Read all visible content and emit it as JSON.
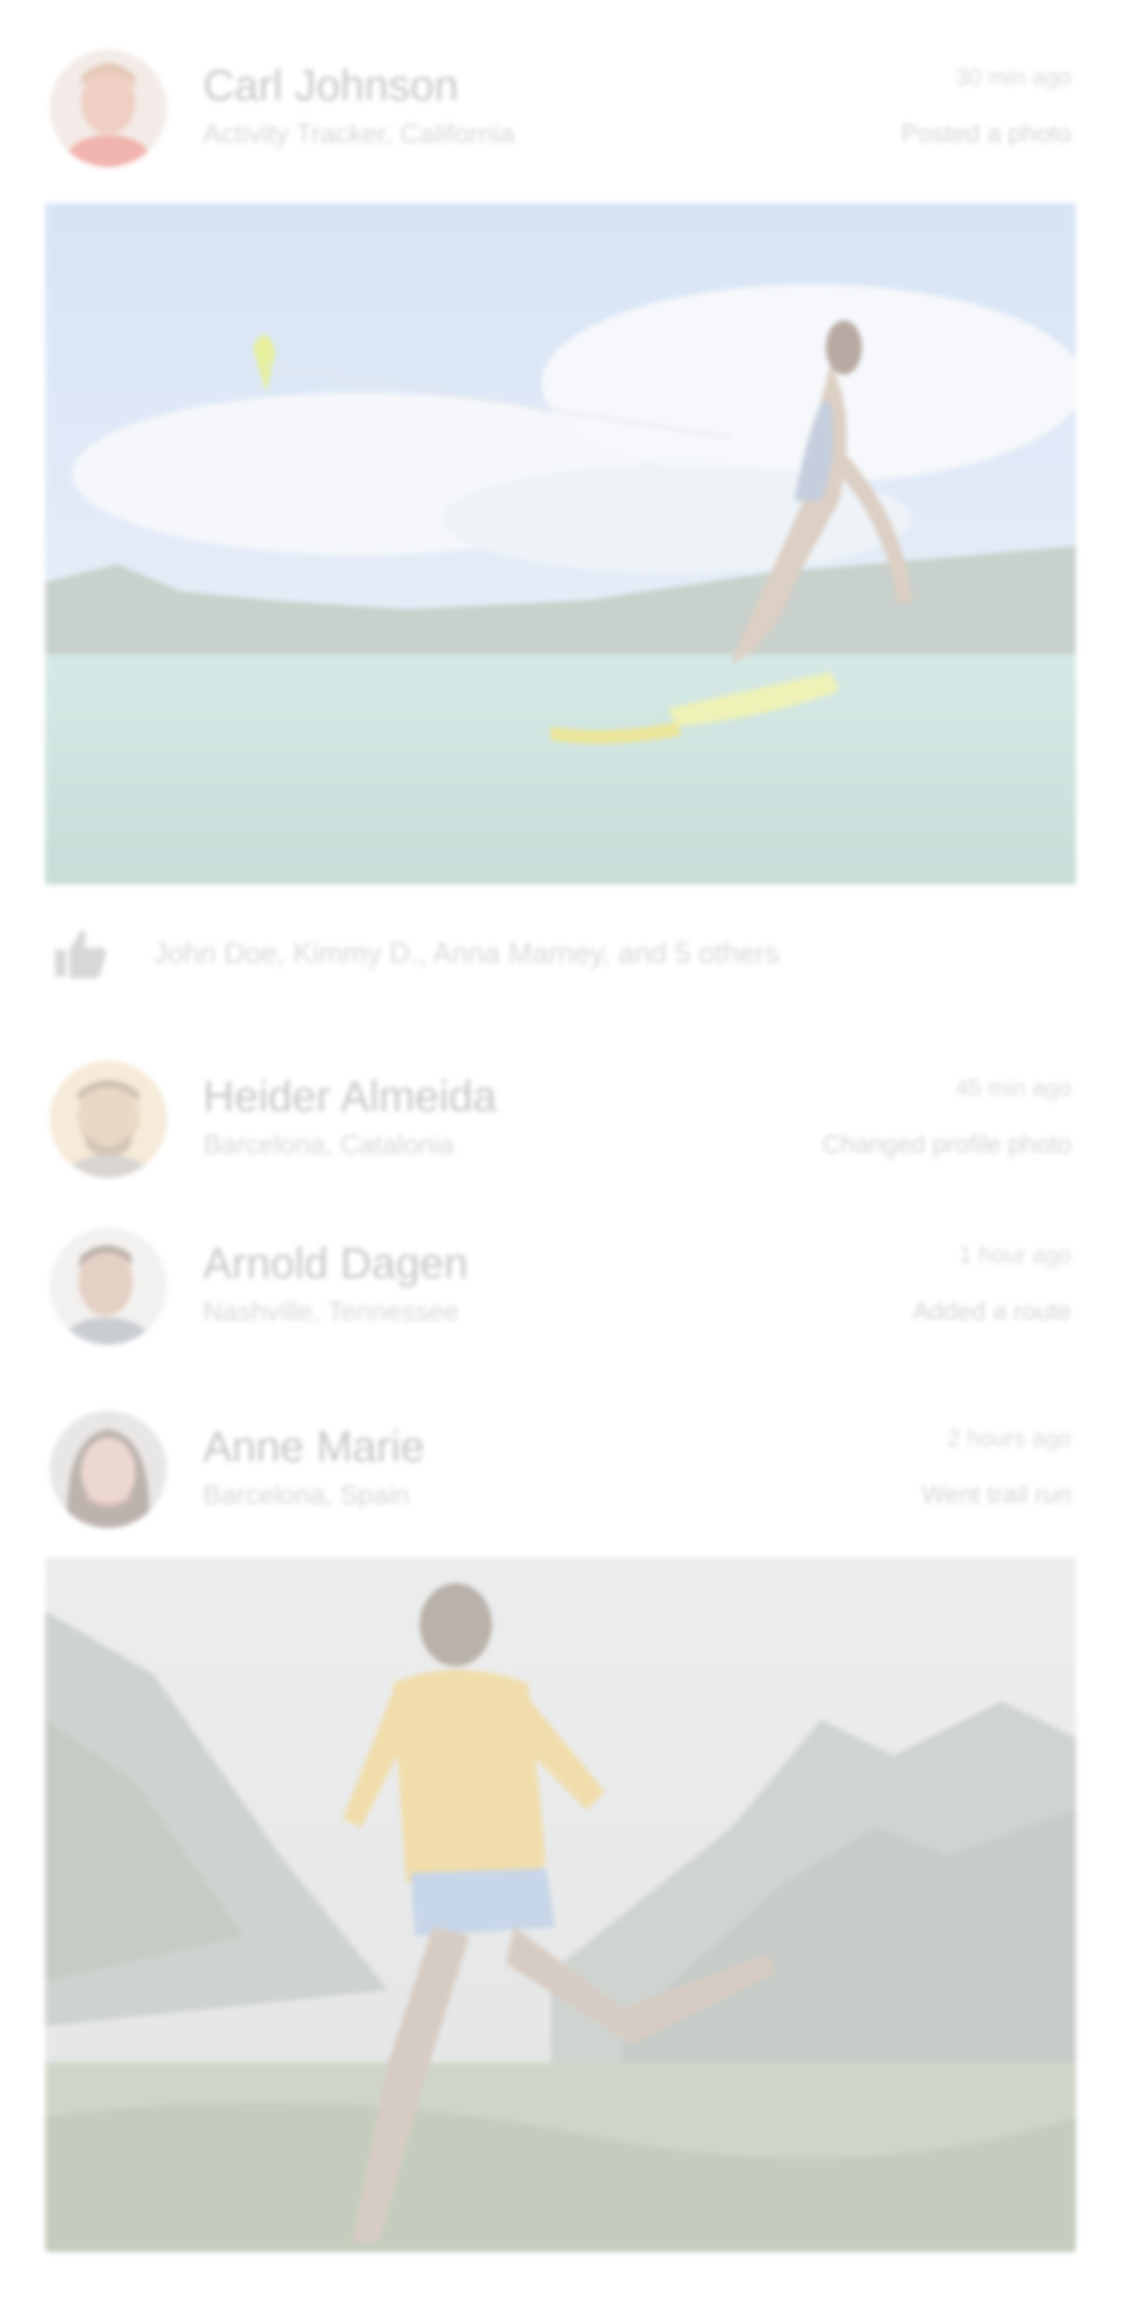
{
  "feed": {
    "posts": [
      {
        "name": "Carl Johnson",
        "subtitle": "Activity Tracker, California",
        "time": "30 min ago",
        "action": "Posted a photo",
        "likes": "John Doe, Kimmy D., Anna Marney, and 5 others"
      },
      {
        "name": "Heider Almeida",
        "subtitle": "Barcelona, Catalonia",
        "time": "45 min ago",
        "action": "Changed profile photo"
      },
      {
        "name": "Arnold Dagen",
        "subtitle": "Nashville, Tennessee",
        "time": "1 hour ago",
        "action": "Added a route"
      },
      {
        "name": "Anne Marie",
        "subtitle": "Barcelona, Spain",
        "time": "2 hours ago",
        "action": "Went trail run"
      }
    ]
  },
  "icons": {
    "like": "thumbs-up-icon"
  },
  "colors": {
    "text_faded": "#c9c9c9",
    "background": "#ffffff"
  }
}
